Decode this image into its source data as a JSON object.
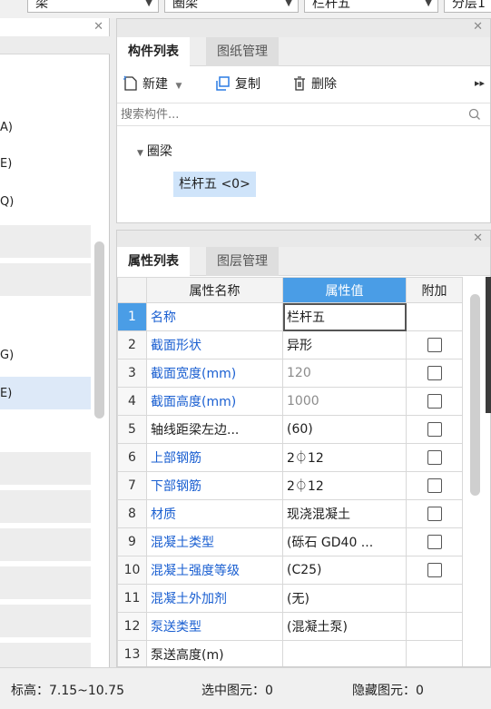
{
  "topbar": {
    "dropdown1": "梁",
    "dropdown2": "圈梁",
    "dropdown3": "栏杆五",
    "dropdown4": "分层1"
  },
  "left_panel": {
    "items": [
      "A)",
      "E)",
      "Q)",
      "G)",
      "E)"
    ]
  },
  "component_panel": {
    "tabs": [
      "构件列表",
      "图纸管理"
    ],
    "toolbar": {
      "new_label": "新建",
      "copy_label": "复制",
      "delete_label": "删除"
    },
    "search": {
      "placeholder": "搜索构件..."
    },
    "tree": {
      "group": "圈梁",
      "node": "栏杆五 <0>"
    }
  },
  "property_panel": {
    "tabs": [
      "属性列表",
      "图层管理"
    ],
    "columns": {
      "name": "属性名称",
      "value": "属性值",
      "extra": "附加"
    },
    "rows": [
      {
        "num": "1",
        "name": "名称",
        "value": "栏杆五"
      },
      {
        "num": "2",
        "name": "截面形状",
        "value": "异形"
      },
      {
        "num": "3",
        "name": "截面宽度(mm)",
        "value": "120"
      },
      {
        "num": "4",
        "name": "截面高度(mm)",
        "value": "1000"
      },
      {
        "num": "5",
        "name": "轴线距梁左边...",
        "value": "(60)"
      },
      {
        "num": "6",
        "name": "上部钢筋",
        "value": "2⏀12"
      },
      {
        "num": "7",
        "name": "下部钢筋",
        "value": "2⏀12"
      },
      {
        "num": "8",
        "name": "材质",
        "value": "现浇混凝土"
      },
      {
        "num": "9",
        "name": "混凝土类型",
        "value": "(砾石 GD40 ..."
      },
      {
        "num": "10",
        "name": "混凝土强度等级",
        "value": "(C25)"
      },
      {
        "num": "11",
        "name": "混凝土外加剂",
        "value": "(无)"
      },
      {
        "num": "12",
        "name": "泵送类型",
        "value": "(混凝土泵)"
      },
      {
        "num": "13",
        "name": "泵送高度(m)",
        "value": ""
      }
    ]
  },
  "status_bar": {
    "elevation": "标高：7.15~10.75",
    "selected": "选中图元：0",
    "hidden": "隐藏图元：0"
  },
  "colors": {
    "accent": "#4a9de6",
    "link_blue": "#1a5fd1",
    "selected_node": "#cfe4fa"
  }
}
